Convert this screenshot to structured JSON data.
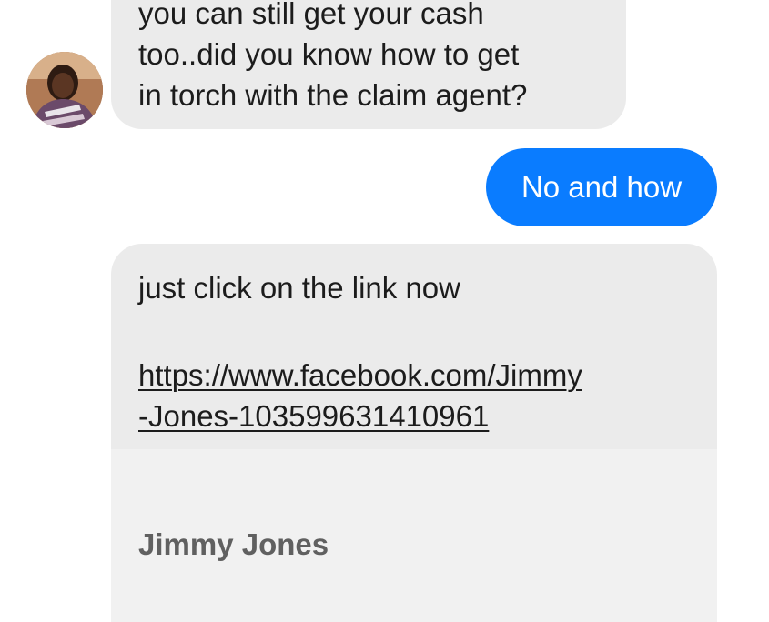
{
  "conversation": {
    "incoming_message_1": {
      "lines": [
        "you can still get your cash",
        "too..did you know how to get",
        "in torch with the claim agent?"
      ]
    },
    "outgoing_message": {
      "text": "No and how"
    },
    "incoming_message_2": {
      "text": "just click on the link now",
      "link_lines": [
        "https://www.facebook.com/Jimmy",
        "-Jones-103599631410961"
      ]
    },
    "link_preview": {
      "title": "Jimmy Jones"
    }
  },
  "colors": {
    "incoming_bubble": "#ebebeb",
    "outgoing_bubble": "#0a7cff",
    "preview_background": "#f1f1f1",
    "preview_title": "#606060"
  },
  "icons": {
    "sender_avatar": "profile-photo"
  }
}
